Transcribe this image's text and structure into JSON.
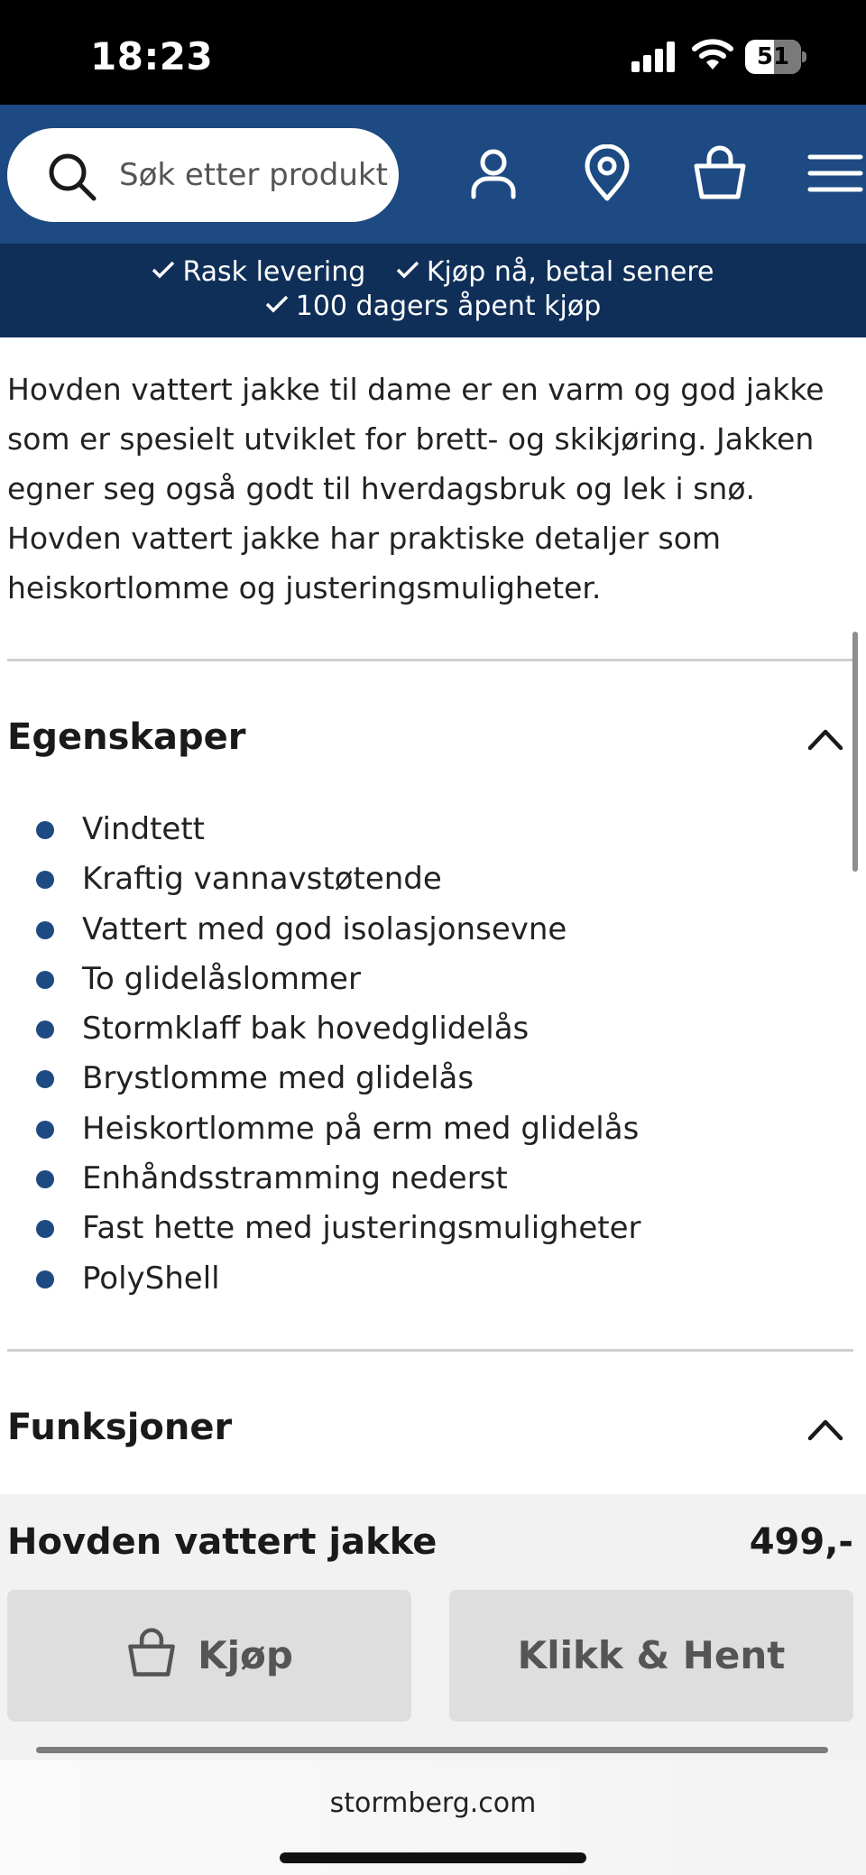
{
  "status_bar": {
    "time": "18:23",
    "battery_level": "51"
  },
  "header": {
    "search_placeholder": "Søk etter produkter",
    "brand_color": "#1d4a82",
    "icons": [
      "search-icon",
      "account-icon",
      "store-location-icon",
      "cart-icon",
      "menu-icon"
    ]
  },
  "usp": {
    "items": [
      "Rask levering",
      "Kjøp nå, betal senere",
      "100 dagers åpent kjøp"
    ]
  },
  "description": "Hovden vattert jakke til dame er en varm og god jakke som er spesielt utviklet for brett- og skikjøring. Jakken egner seg også godt til hverdagsbruk og lek i snø. Hovden vattert jakke har praktiske detaljer som heiskortlomme og justeringsmuligheter.",
  "sections": {
    "features": {
      "title": "Egenskaper",
      "items": [
        "Vindtett",
        "Kraftig vannavstøtende",
        "Vattert med god isolasjonsevne",
        "To glidelåslommer",
        "Stormklaff bak hovedglidelås",
        "Brystlomme med glidelås",
        "Heiskortlomme på erm med glidelås",
        "Enhåndsstramming nederst",
        "Fast hette med justeringsmuligheter",
        "PolyShell"
      ]
    },
    "functions": {
      "title": "Funksjoner"
    }
  },
  "product": {
    "name": "Hovden vattert jakke",
    "price": "499,-",
    "buy_label": "Kjøp",
    "collect_label": "Klikk & Hent"
  },
  "browser": {
    "url": "stormberg.com"
  }
}
